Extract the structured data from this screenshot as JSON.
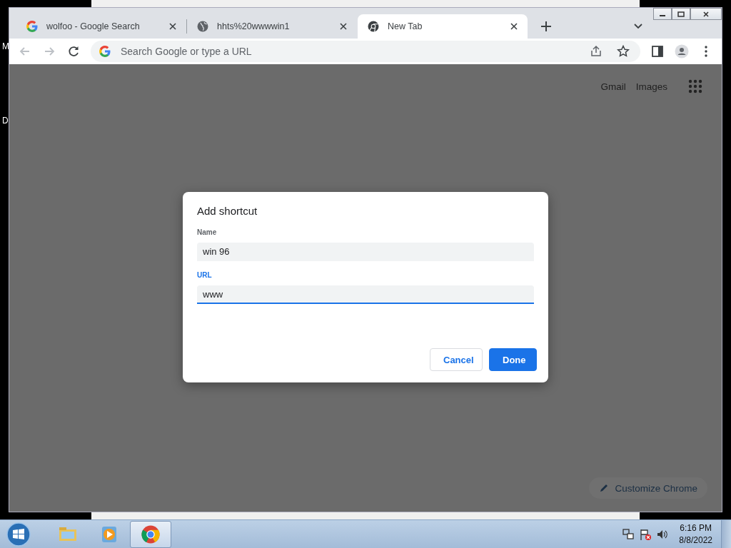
{
  "desktop": {
    "edge_labels": [
      "M",
      "D"
    ]
  },
  "browser": {
    "tabs": [
      {
        "title": "wolfoo - Google Search",
        "kind": "google",
        "selected": false
      },
      {
        "title": "hhts%20wwwwin1",
        "kind": "globe",
        "selected": false
      },
      {
        "title": "New Tab",
        "kind": "chrome",
        "selected": true
      }
    ],
    "address_bar": {
      "placeholder": "Search Google or type a URL"
    },
    "page": {
      "header_links": [
        "Gmail",
        "Images"
      ],
      "customize_button": "Customize Chrome"
    },
    "dialog": {
      "title": "Add shortcut",
      "fields": [
        {
          "label": "Name",
          "value": "win 96",
          "focused": false
        },
        {
          "label": "URL",
          "value": "www",
          "focused": true
        }
      ],
      "buttons": [
        {
          "label": "Cancel",
          "kind": "secondary"
        },
        {
          "label": "Done",
          "kind": "primary"
        }
      ]
    }
  },
  "taskbar": {
    "apps": [
      {
        "kind": "explorer",
        "selected": false
      },
      {
        "kind": "media",
        "selected": false
      },
      {
        "kind": "chrome",
        "selected": true
      }
    ],
    "clock": {
      "time": "6:16 PM",
      "date": "8/8/2022"
    }
  }
}
